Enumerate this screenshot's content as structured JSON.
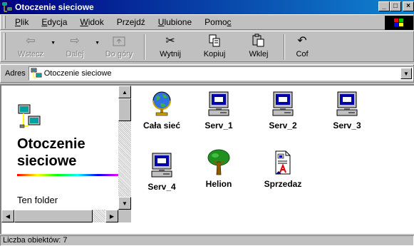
{
  "window": {
    "title": "Otoczenie sieciowe",
    "title_icon": "network-neighborhood-icon"
  },
  "window_buttons": {
    "minimize": "_",
    "maximize": "□",
    "close": "×"
  },
  "menubar": {
    "items": [
      {
        "label": "Plik",
        "underline": "P",
        "rest": "lik"
      },
      {
        "label": "Edycja",
        "underline": "E",
        "rest": "dycja"
      },
      {
        "label": "Widok",
        "underline": "W",
        "rest": "idok"
      },
      {
        "label": "Przejdź",
        "pre": "Prze",
        "underline": "j",
        "rest": "dź"
      },
      {
        "label": "Ulubione",
        "underline": "U",
        "rest": "lubione"
      },
      {
        "label": "Pomoc",
        "pre": "Pomo",
        "underline": "c",
        "rest": ""
      }
    ]
  },
  "toolbar": {
    "back": {
      "label": "Wstecz",
      "icon": "back-arrow-icon",
      "enabled": false
    },
    "forward": {
      "label": "Dalej",
      "icon": "forward-arrow-icon",
      "enabled": false
    },
    "up": {
      "label": "Do góry",
      "icon": "up-folder-icon",
      "enabled": false
    },
    "cut": {
      "label": "Wytnij",
      "icon": "scissors-icon",
      "enabled": true
    },
    "copy": {
      "label": "Kopiuj",
      "icon": "copy-icon",
      "enabled": true
    },
    "paste": {
      "label": "Wklej",
      "icon": "paste-icon",
      "enabled": true
    },
    "undo": {
      "label": "Cof",
      "icon": "undo-icon",
      "enabled": true
    }
  },
  "address": {
    "label": "Adres",
    "value": "Otoczenie sieciowe"
  },
  "left_pane": {
    "title_line1": "Otoczenie",
    "title_line2": "sieciowe",
    "subtitle": "Ten folder"
  },
  "items": [
    {
      "label": "Cała sieć",
      "icon": "globe-icon"
    },
    {
      "label": "Serv_1",
      "icon": "computer-icon"
    },
    {
      "label": "Serv_2",
      "icon": "computer-icon"
    },
    {
      "label": "Serv_3",
      "icon": "computer-icon"
    },
    {
      "label": "Serv_4",
      "icon": "computer-icon"
    },
    {
      "label": "Helion",
      "icon": "tree-icon"
    },
    {
      "label": "Sprzedaz",
      "icon": "document-icon"
    }
  ],
  "status": {
    "text": "Liczba obiektów: 7"
  },
  "colors": {
    "titlebar_start": "#000080",
    "titlebar_end": "#1084d0",
    "face": "#c0c0c0",
    "screen": "#0000a8"
  }
}
